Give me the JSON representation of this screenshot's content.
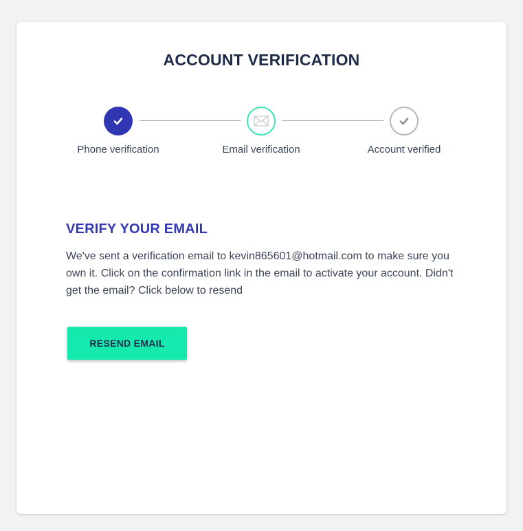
{
  "page": {
    "title": "ACCOUNT VERIFICATION"
  },
  "steps": [
    {
      "label": "Phone verification",
      "status": "completed",
      "icon": "check-icon"
    },
    {
      "label": "Email verification",
      "status": "current",
      "icon": "envelope-icon"
    },
    {
      "label": "Account verified",
      "status": "pending",
      "icon": "check-icon"
    }
  ],
  "verify": {
    "heading": "VERIFY YOUR EMAIL",
    "message": "We've sent a verification email to kevin865601@hotmail.com to make sure you own it. Click on the confirmation link in the email to activate your account. Didn't get the email? Click below to resend",
    "resend_label": "RESEND EMAIL"
  },
  "colors": {
    "background": "#f2f2f2",
    "card": "#ffffff",
    "primary_indigo": "#3035b2",
    "accent_mint": "#16e9ae",
    "current_ring": "#3be6b3",
    "pending_gray": "#b7b7b7",
    "title_text": "#1d2a48",
    "body_text": "#3c4658"
  }
}
